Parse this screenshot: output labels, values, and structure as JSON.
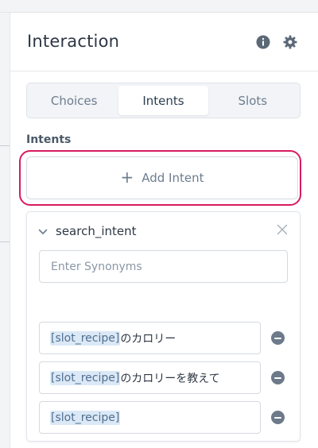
{
  "panel": {
    "title": "Interaction"
  },
  "tabs": [
    {
      "label": "Choices",
      "active": false
    },
    {
      "label": "Intents",
      "active": true
    },
    {
      "label": "Slots",
      "active": false
    }
  ],
  "intents_section": {
    "label": "Intents",
    "add_button_label": "Add Intent",
    "highlight_color": "#d81b60"
  },
  "intent": {
    "name": "search_intent",
    "synonyms_placeholder": "Enter Synonyms",
    "utterances": [
      {
        "slot": "[slot_recipe]",
        "text": " のカロリー"
      },
      {
        "slot": "[slot_recipe]",
        "text": " のカロリーを教えて"
      },
      {
        "slot": "[slot_recipe]",
        "text": ""
      }
    ]
  },
  "icons": {
    "info": "info-icon",
    "settings": "gear-icon",
    "collapse": "chevron-down-icon",
    "close": "close-icon",
    "remove": "minus-circle-icon"
  }
}
